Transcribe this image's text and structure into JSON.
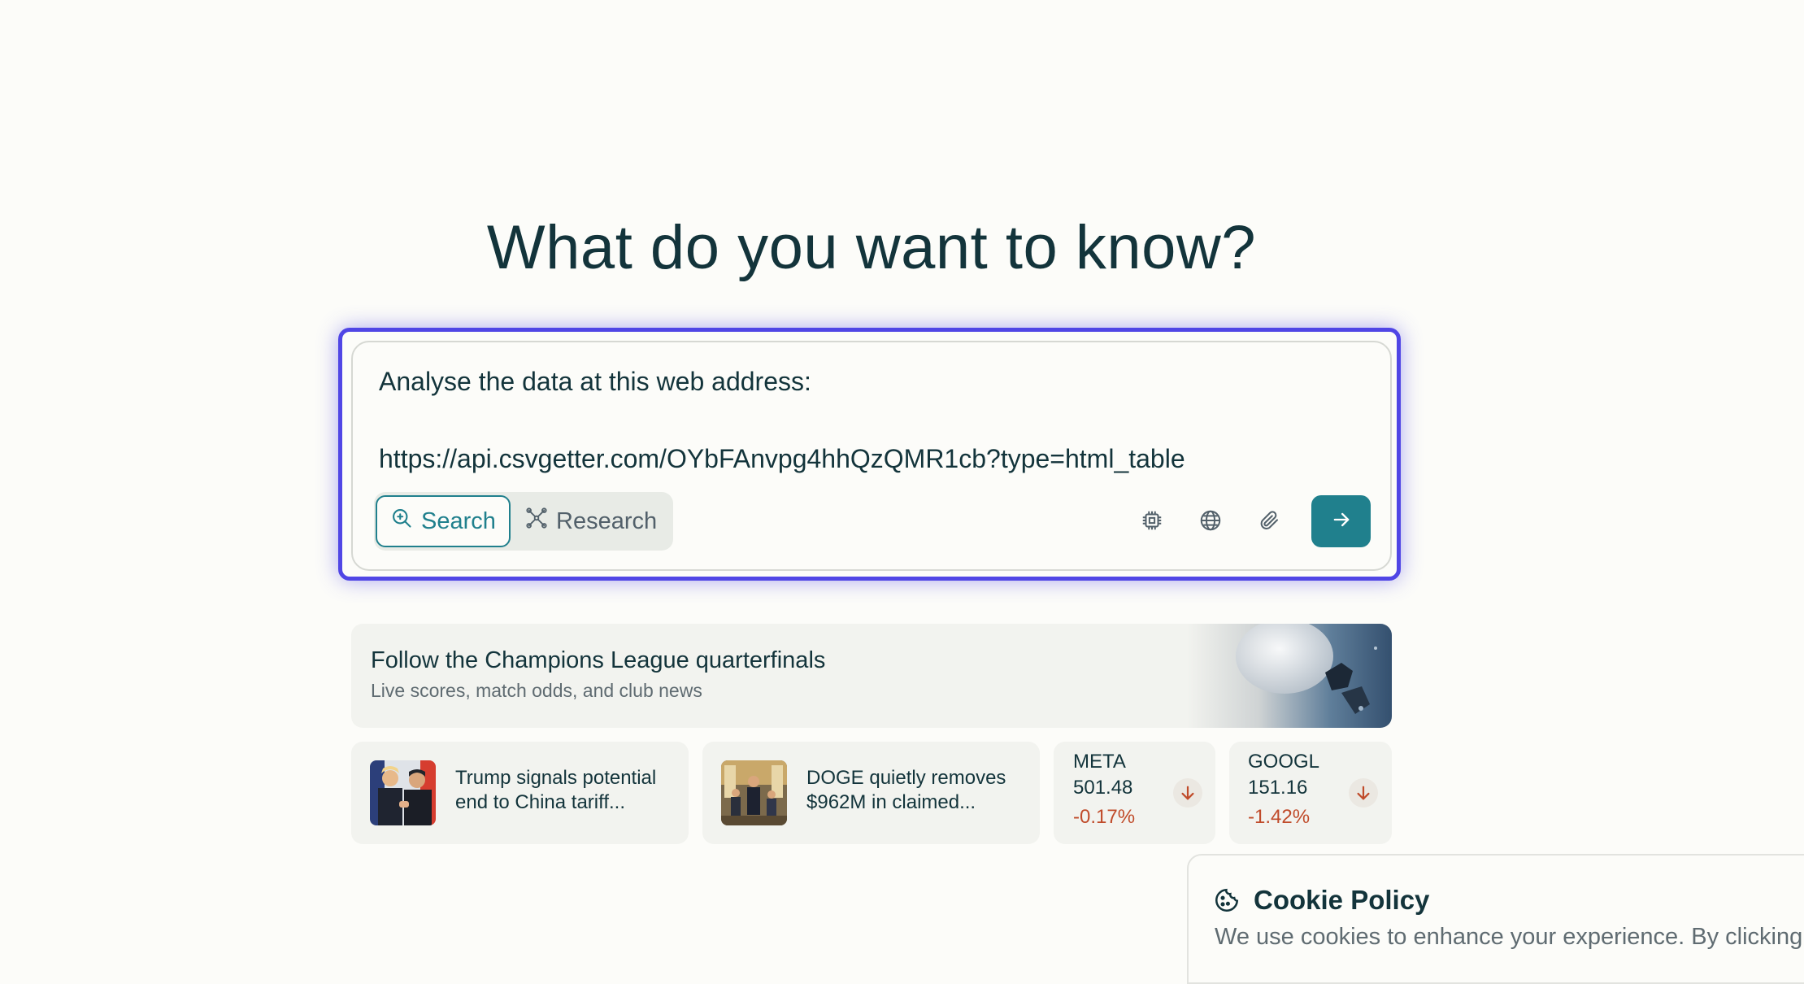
{
  "hero": {
    "title": "What do you want to know?"
  },
  "query": {
    "line1": "Analyse the data at this web address:",
    "line2": "https://api.csvgetter.com/OYbFAnvpg4hhQzQMR1cb?type=html_table"
  },
  "modes": {
    "search_label": "Search",
    "research_label": "Research"
  },
  "tools": [
    "cpu-icon",
    "globe-icon",
    "paperclip-icon"
  ],
  "banner": {
    "title": "Follow the Champions League quarterfinals",
    "subtitle": "Live scores, match odds, and club news"
  },
  "news": [
    {
      "title": "Trump signals potential end to China tariff..."
    },
    {
      "title": "DOGE quietly removes $962M in claimed..."
    }
  ],
  "stocks": [
    {
      "symbol": "META",
      "price": "501.48",
      "change": "-0.17%"
    },
    {
      "symbol": "GOOGL",
      "price": "151.16",
      "change": "-1.42%"
    }
  ],
  "cookie": {
    "title": "Cookie Policy",
    "text": "We use cookies to enhance your experience. By clicking"
  },
  "colors": {
    "accent": "#20808d",
    "focus": "#5046e5",
    "negative": "#c04b2a",
    "background": "#fcfcf9"
  }
}
